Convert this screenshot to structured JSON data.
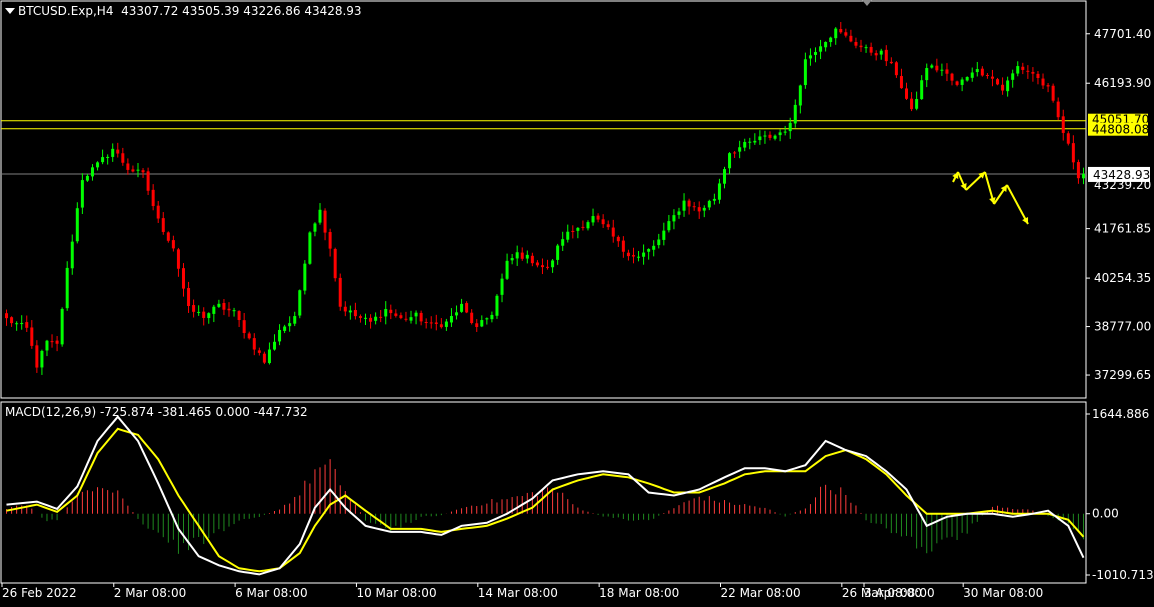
{
  "header": {
    "symbol": "BTCUSD.Exp,H4",
    "ohlc": "43307.72 43505.39 43226.86 43428.93",
    "text": "BTCUSD.Exp,H4  43307.72 43505.39 43226.86 43428.93"
  },
  "macd_header": {
    "text": "MACD(12,26,9) -725.874 -381.465 0.000 -447.732",
    "macd": -725.874,
    "signal": -381.465,
    "histogram": -447.732
  },
  "colors": {
    "background": "#000000",
    "bull_candle": "#00ff00",
    "bear_candle": "#ff0000",
    "level_line": "#ffff00",
    "bid_line": "#808080",
    "macd_line": "#ffffff",
    "signal_line": "#ffff00",
    "hist_positive": "#ff3c3c",
    "hist_negative": "#1f8a1f",
    "axis": "#ffffff",
    "forecast_arrow": "#ffff00"
  },
  "chart_data": [
    {
      "type": "candlestick",
      "symbol": "BTCUSD.Exp",
      "timeframe": "H4",
      "ylim": [
        36600,
        48700
      ],
      "y_ticks": [
        "47701.40",
        "46193.90",
        "41761.85",
        "40254.35",
        "38777.00",
        "37299.65"
      ],
      "level_lines": [
        {
          "value": 45051.7,
          "label": "45051.70"
        },
        {
          "value": 44808.08,
          "label": "44808.08"
        }
      ],
      "current_price": {
        "value": 43428.93,
        "label": "43428.93"
      },
      "partially_hidden_label": "43239.20",
      "x_ticks": [
        "26 Feb 2022",
        "2 Mar 08:00",
        "6 Mar 08:00",
        "10 Mar 08:00",
        "14 Mar 08:00",
        "18 Mar 08:00",
        "22 Mar 08:00",
        "26 Mar 08:00",
        "30 Mar 08:00",
        "3 Apr 08:00"
      ],
      "close_path": [
        [
          0,
          39000
        ],
        [
          4,
          38700
        ],
        [
          6,
          37600
        ],
        [
          8,
          38300
        ],
        [
          10,
          38200
        ],
        [
          12,
          40500
        ],
        [
          15,
          43300
        ],
        [
          18,
          43700
        ],
        [
          21,
          44200
        ],
        [
          24,
          43600
        ],
        [
          27,
          43400
        ],
        [
          30,
          42000
        ],
        [
          33,
          41200
        ],
        [
          36,
          39300
        ],
        [
          39,
          39100
        ],
        [
          42,
          39400
        ],
        [
          45,
          39200
        ],
        [
          48,
          38400
        ],
        [
          51,
          37700
        ],
        [
          54,
          38700
        ],
        [
          57,
          39000
        ],
        [
          60,
          41700
        ],
        [
          62,
          42300
        ],
        [
          64,
          41200
        ],
        [
          66,
          39400
        ],
        [
          69,
          39100
        ],
        [
          72,
          38900
        ],
        [
          75,
          39300
        ],
        [
          78,
          39000
        ],
        [
          81,
          39100
        ],
        [
          84,
          38800
        ],
        [
          87,
          38900
        ],
        [
          90,
          39400
        ],
        [
          93,
          38700
        ],
        [
          96,
          39200
        ],
        [
          99,
          40700
        ],
        [
          101,
          41000
        ],
        [
          104,
          40800
        ],
        [
          107,
          40500
        ],
        [
          110,
          41500
        ],
        [
          113,
          41800
        ],
        [
          116,
          42100
        ],
        [
          119,
          41700
        ],
        [
          122,
          41100
        ],
        [
          125,
          40900
        ],
        [
          128,
          41200
        ],
        [
          131,
          41900
        ],
        [
          134,
          42600
        ],
        [
          137,
          42300
        ],
        [
          140,
          42700
        ],
        [
          143,
          44100
        ],
        [
          146,
          44300
        ],
        [
          149,
          44500
        ],
        [
          152,
          44600
        ],
        [
          155,
          44900
        ],
        [
          158,
          46900
        ],
        [
          161,
          47400
        ],
        [
          164,
          47800
        ],
        [
          167,
          47500
        ],
        [
          170,
          47200
        ],
        [
          173,
          47100
        ],
        [
          176,
          46500
        ],
        [
          179,
          45300
        ],
        [
          182,
          46700
        ],
        [
          185,
          46600
        ],
        [
          188,
          46100
        ],
        [
          191,
          46600
        ],
        [
          194,
          46500
        ],
        [
          197,
          46000
        ],
        [
          200,
          46700
        ],
        [
          203,
          46500
        ],
        [
          206,
          46000
        ],
        [
          209,
          44700
        ],
        [
          212,
          43400
        ],
        [
          213,
          43429
        ]
      ]
    },
    {
      "type": "macd",
      "title": "MACD(12,26,9)",
      "ylim": [
        -1010.713,
        1644.886
      ],
      "y_ticks": [
        "1644.886",
        "0.00",
        "-1010.713"
      ],
      "macd_path": [
        [
          0,
          150
        ],
        [
          6,
          200
        ],
        [
          10,
          80
        ],
        [
          14,
          450
        ],
        [
          18,
          1200
        ],
        [
          22,
          1600
        ],
        [
          26,
          1200
        ],
        [
          30,
          500
        ],
        [
          34,
          -250
        ],
        [
          38,
          -700
        ],
        [
          42,
          -850
        ],
        [
          46,
          -950
        ],
        [
          50,
          -1000
        ],
        [
          54,
          -900
        ],
        [
          58,
          -500
        ],
        [
          61,
          100
        ],
        [
          64,
          400
        ],
        [
          67,
          100
        ],
        [
          71,
          -200
        ],
        [
          76,
          -300
        ],
        [
          82,
          -300
        ],
        [
          86,
          -350
        ],
        [
          90,
          -200
        ],
        [
          95,
          -150
        ],
        [
          99,
          0
        ],
        [
          104,
          250
        ],
        [
          108,
          550
        ],
        [
          113,
          650
        ],
        [
          118,
          700
        ],
        [
          123,
          650
        ],
        [
          127,
          350
        ],
        [
          132,
          300
        ],
        [
          137,
          400
        ],
        [
          142,
          600
        ],
        [
          146,
          750
        ],
        [
          150,
          750
        ],
        [
          154,
          700
        ],
        [
          158,
          800
        ],
        [
          162,
          1200
        ],
        [
          166,
          1050
        ],
        [
          170,
          950
        ],
        [
          174,
          700
        ],
        [
          178,
          400
        ],
        [
          182,
          -200
        ],
        [
          186,
          -50
        ],
        [
          190,
          0
        ],
        [
          195,
          0
        ],
        [
          199,
          -50
        ],
        [
          203,
          0
        ],
        [
          206,
          50
        ],
        [
          210,
          -200
        ],
        [
          213,
          -726
        ]
      ],
      "signal_path": [
        [
          0,
          50
        ],
        [
          6,
          150
        ],
        [
          10,
          30
        ],
        [
          14,
          300
        ],
        [
          18,
          1000
        ],
        [
          22,
          1400
        ],
        [
          26,
          1300
        ],
        [
          30,
          900
        ],
        [
          34,
          300
        ],
        [
          38,
          -200
        ],
        [
          42,
          -700
        ],
        [
          46,
          -900
        ],
        [
          50,
          -950
        ],
        [
          54,
          -900
        ],
        [
          58,
          -650
        ],
        [
          61,
          -200
        ],
        [
          64,
          150
        ],
        [
          67,
          300
        ],
        [
          71,
          50
        ],
        [
          76,
          -250
        ],
        [
          82,
          -250
        ],
        [
          86,
          -300
        ],
        [
          90,
          -250
        ],
        [
          95,
          -200
        ],
        [
          99,
          -80
        ],
        [
          104,
          100
        ],
        [
          108,
          400
        ],
        [
          113,
          550
        ],
        [
          118,
          650
        ],
        [
          123,
          600
        ],
        [
          127,
          500
        ],
        [
          132,
          350
        ],
        [
          137,
          350
        ],
        [
          142,
          500
        ],
        [
          146,
          650
        ],
        [
          150,
          700
        ],
        [
          154,
          700
        ],
        [
          158,
          700
        ],
        [
          162,
          950
        ],
        [
          166,
          1050
        ],
        [
          170,
          900
        ],
        [
          174,
          650
        ],
        [
          178,
          300
        ],
        [
          182,
          0
        ],
        [
          186,
          0
        ],
        [
          190,
          0
        ],
        [
          195,
          50
        ],
        [
          199,
          0
        ],
        [
          203,
          0
        ],
        [
          206,
          0
        ],
        [
          210,
          -100
        ],
        [
          213,
          -381
        ]
      ],
      "histogram_envelope": [
        [
          0,
          100
        ],
        [
          4,
          150
        ],
        [
          8,
          -150
        ],
        [
          10,
          -100
        ],
        [
          14,
          300
        ],
        [
          18,
          550
        ],
        [
          22,
          400
        ],
        [
          26,
          -100
        ],
        [
          30,
          -400
        ],
        [
          34,
          -600
        ],
        [
          38,
          -500
        ],
        [
          42,
          -300
        ],
        [
          46,
          -100
        ],
        [
          50,
          -50
        ],
        [
          54,
          80
        ],
        [
          58,
          350
        ],
        [
          61,
          750
        ],
        [
          64,
          800
        ],
        [
          67,
          400
        ],
        [
          71,
          -100
        ],
        [
          76,
          -300
        ],
        [
          82,
          -50
        ],
        [
          86,
          -30
        ],
        [
          90,
          100
        ],
        [
          95,
          200
        ],
        [
          99,
          250
        ],
        [
          104,
          350
        ],
        [
          108,
          450
        ],
        [
          113,
          100
        ],
        [
          118,
          -50
        ],
        [
          123,
          -100
        ],
        [
          127,
          -120
        ],
        [
          132,
          100
        ],
        [
          137,
          300
        ],
        [
          142,
          200
        ],
        [
          146,
          150
        ],
        [
          150,
          100
        ],
        [
          154,
          -50
        ],
        [
          158,
          100
        ],
        [
          162,
          500
        ],
        [
          166,
          350
        ],
        [
          170,
          -100
        ],
        [
          174,
          -250
        ],
        [
          178,
          -400
        ],
        [
          182,
          -650
        ],
        [
          186,
          -500
        ],
        [
          190,
          -300
        ],
        [
          195,
          150
        ],
        [
          199,
          100
        ],
        [
          203,
          50
        ],
        [
          206,
          -50
        ],
        [
          210,
          -150
        ],
        [
          213,
          -448
        ]
      ]
    }
  ]
}
